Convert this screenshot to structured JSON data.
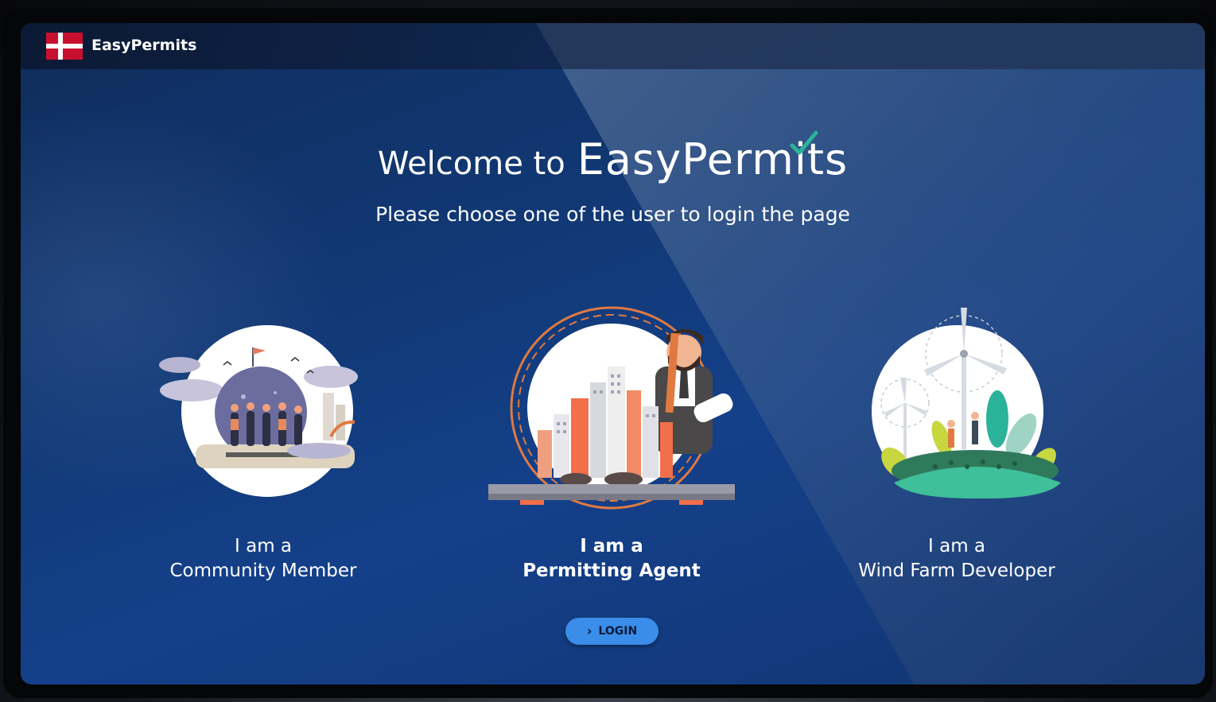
{
  "header": {
    "brand_name": "EasyPermits"
  },
  "hero": {
    "welcome_prefix": "Welcome to",
    "logo_text": "EasyPermits",
    "subtitle": "Please choose one of the user to login the page"
  },
  "roles": [
    {
      "line1": "I am a",
      "line2": "Community Member",
      "selected": false
    },
    {
      "line1": "I am a",
      "line2": "Permitting Agent",
      "selected": true
    },
    {
      "line1": "I am a",
      "line2": "Wind Farm Developer",
      "selected": false
    }
  ],
  "login_button": {
    "label": "LOGIN"
  },
  "icons": {
    "flag": "denmark-flag-icon",
    "login": "chevron-right-icon"
  },
  "colors": {
    "accent_blue": "#3a8de8",
    "flag_red": "#c8102e",
    "check_green": "#2bb39a",
    "background_blue": "#123a78"
  }
}
